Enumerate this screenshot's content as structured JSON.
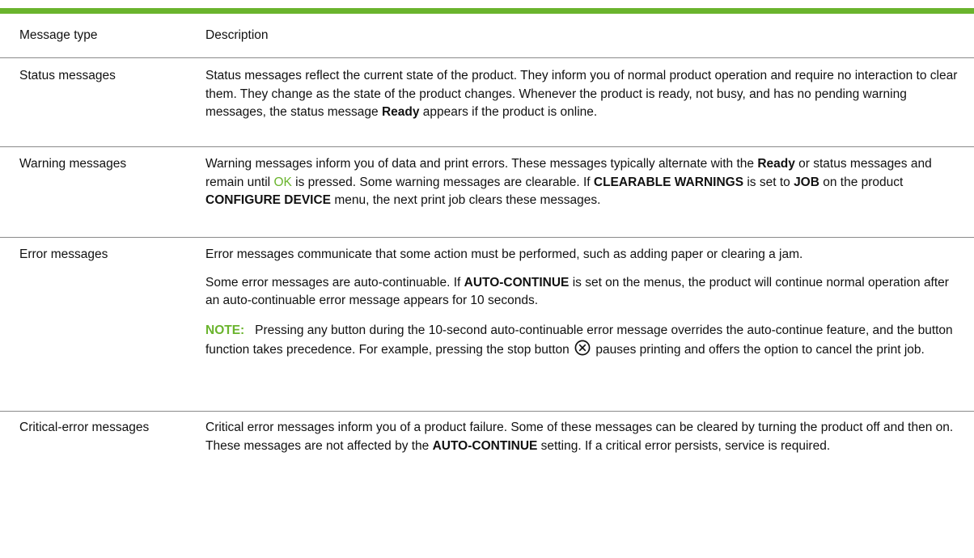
{
  "table": {
    "header": {
      "col1": "Message type",
      "col2": "Description"
    },
    "rows": {
      "status": {
        "type": "Status messages",
        "t1": "Status messages reflect the current state of the product. They inform you of normal product operation and require no interaction to clear them. They change as the state of the product changes. Whenever the product is ready, not busy, and has no pending warning messages, the status message ",
        "b1": "Ready",
        "t2": " appears if the product is online."
      },
      "warning": {
        "type": "Warning messages",
        "t1": "Warning messages inform you of data and print errors. These messages typically alternate with the ",
        "b1": "Ready",
        "t2": " or status messages and remain until ",
        "ok": "OK",
        "t3": " is pressed. Some warning messages are clearable. If ",
        "b2": "CLEARABLE WARNINGS",
        "t4": " is set to ",
        "b3": "JOB",
        "t5": " on the product ",
        "b4": "CONFIGURE DEVICE",
        "t6": " menu, the next print job clears these messages."
      },
      "error": {
        "type": "Error messages",
        "p1": "Error messages communicate that some action must be performed, such as adding paper or clearing a jam.",
        "p2_t1": "Some error messages are auto-continuable. If ",
        "p2_b1": "AUTO-CONTINUE",
        "p2_t2": " is set on the menus, the product will continue normal operation after an auto-continuable error message appears for 10 seconds.",
        "note_label": "NOTE:",
        "note_t1": "   Pressing any button during the 10-second auto-continuable error message overrides the auto-continue feature, and the button function takes precedence. For example, pressing the stop button ",
        "note_icon": "stop-icon",
        "note_t2": " pauses printing and offers the option to cancel the print job."
      },
      "critical": {
        "type": "Critical-error messages",
        "t1": "Critical error messages inform you of a product failure. Some of these messages can be cleared by turning the product off and then on. These messages are not affected by the ",
        "b1": "AUTO-CONTINUE",
        "t2": " setting. If a critical error persists, service is required."
      }
    }
  },
  "colors": {
    "accent_green": "#6ab42d",
    "rule_gray": "#8a8a8a",
    "text": "#111111"
  }
}
